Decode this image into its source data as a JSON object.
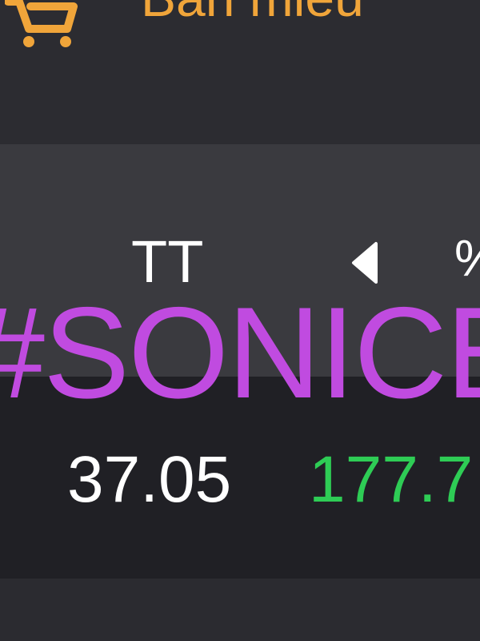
{
  "header": {
    "brand_title": "Ban mieu",
    "cart_icon": "shopping-cart-icon"
  },
  "table": {
    "columns": {
      "tt": "TT",
      "pct": "%"
    },
    "sort_icon": "triangle-left-icon",
    "row": {
      "price": "37.05",
      "change": "177.7"
    }
  },
  "overlay": {
    "hashtag": "#SONICE"
  },
  "colors": {
    "brand": "#f0a53a",
    "positive": "#2ecc55",
    "hashtag": "#c04be0"
  }
}
